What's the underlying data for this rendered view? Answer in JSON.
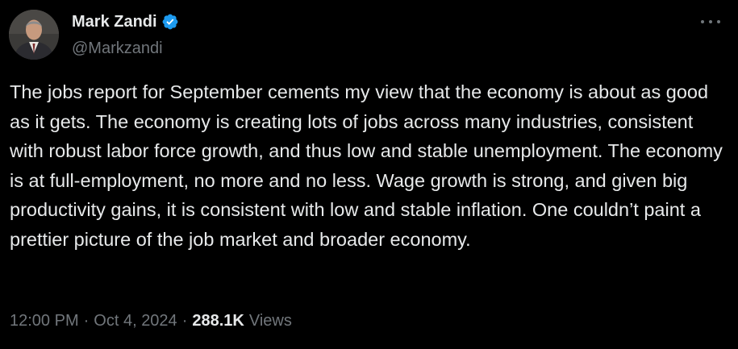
{
  "author": {
    "display_name": "Mark Zandi",
    "handle": "@Markzandi",
    "verified": true,
    "verified_color": "#1d9bf0"
  },
  "tweet": {
    "text": "The jobs report for September cements my view that the economy is about as good as it gets. The economy is creating lots of jobs across many industries, consistent with robust labor force growth, and thus low and stable unemployment. The economy is at full-employment, no more and no less. Wage growth is strong, and given big productivity gains, it is consistent with low and stable inflation. One couldn’t paint a prettier picture of the job market and broader economy.",
    "time": "12:00 PM",
    "separator": "·",
    "date": "Oct 4, 2024",
    "views_count": "288.1K",
    "views_label": "Views"
  },
  "icons": {
    "more": "more-horizontal-icon",
    "verified": "verified-badge-icon"
  },
  "colors": {
    "background": "#000000",
    "text_primary": "#e7e9ea",
    "text_secondary": "#71767b"
  }
}
